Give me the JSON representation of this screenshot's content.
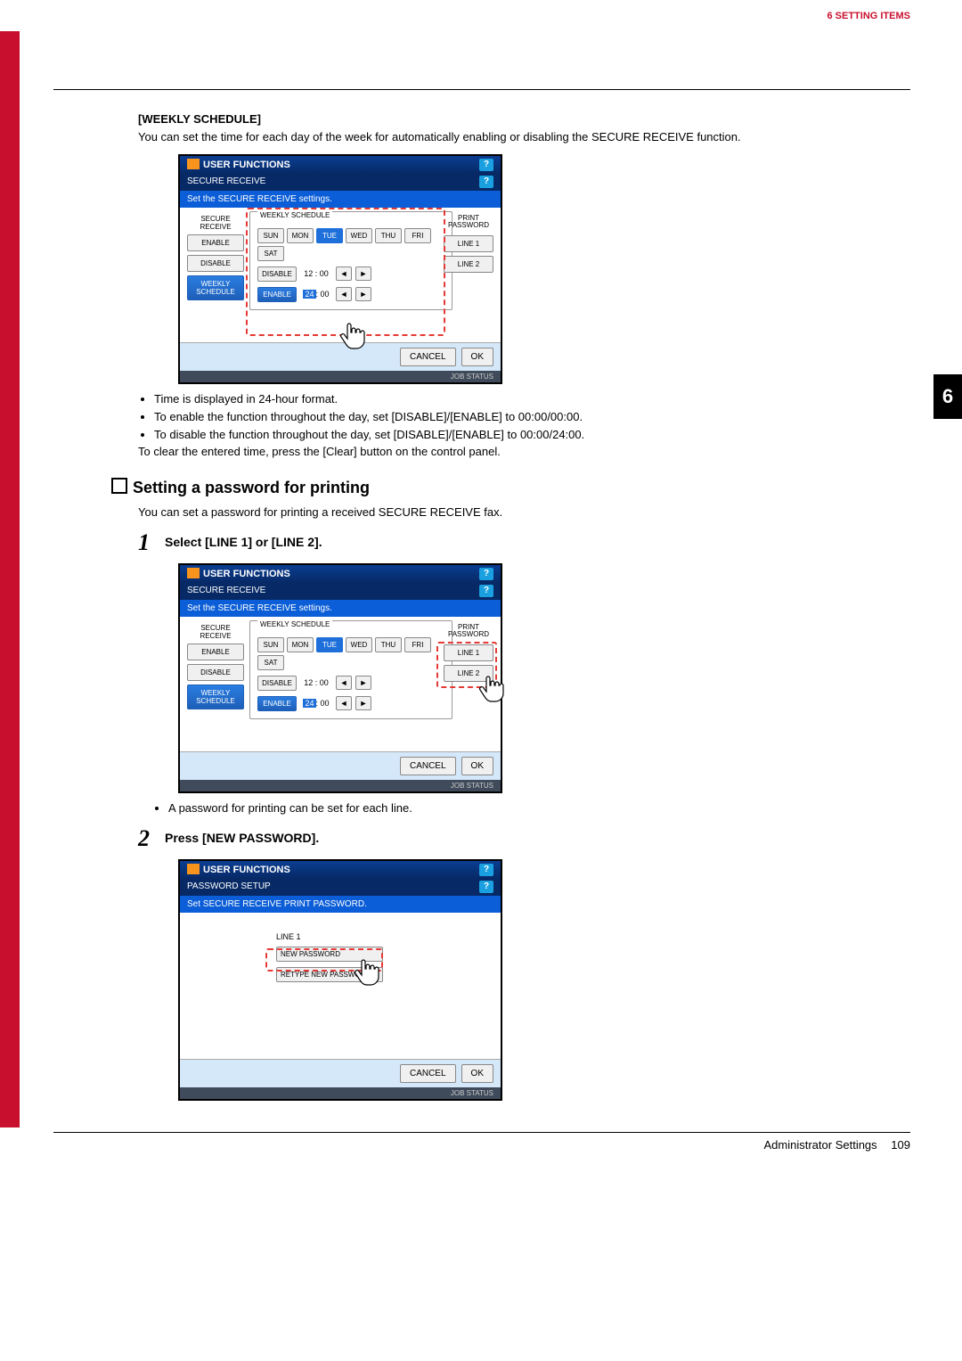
{
  "header": {
    "chapter_prefix": "6",
    "chapter_title": "SETTING ITEMS"
  },
  "chapterTab": "6",
  "weeklySchedule": {
    "heading": "[WEEKLY SCHEDULE]",
    "intro": "You can set the time for each day of the week for automatically enabling or disabling the SECURE RECEIVE function.",
    "bullet1": "Time is displayed in 24-hour format.",
    "bullet2": "To enable the function throughout the day, set [DISABLE]/[ENABLE] to 00:00/00:00.",
    "bullet3": "To disable the function throughout the day, set [DISABLE]/[ENABLE] to 00:00/24:00.",
    "after": "To clear the entered time, press the [Clear] button on the control panel."
  },
  "settingPassword": {
    "heading": "Setting a password for printing",
    "intro": "You can set a password for printing a received SECURE RECEIVE fax.",
    "step1": "Select [LINE 1] or [LINE 2].",
    "step1_bullet": "A password for printing can be set for each line.",
    "step2": "Press [NEW PASSWORD]."
  },
  "screen1": {
    "title": "USER FUNCTIONS",
    "subtitle": "SECURE RECEIVE",
    "instr": "Set the SECURE RECEIVE settings.",
    "left_label": "SECURE RECEIVE",
    "enable": "ENABLE",
    "disable": "DISABLE",
    "weekly": "WEEKLY SCHEDULE",
    "panel_title": "WEEKLY SCHEDULE",
    "days": {
      "sun": "SUN",
      "mon": "MON",
      "tue": "TUE",
      "wed": "WED",
      "thu": "THU",
      "fri": "FRI",
      "sat": "SAT"
    },
    "row_disable": "DISABLE",
    "row_disable_time": "12 : 00",
    "row_enable": "ENABLE",
    "row_enable_time0": "24",
    "row_enable_time1": ": 00",
    "arrow_left": "◄",
    "arrow_right": "►",
    "right_label": "PRINT PASSWORD",
    "line1": "LINE 1",
    "line2": "LINE 2",
    "cancel": "CANCEL",
    "ok": "OK",
    "status": "JOB STATUS",
    "help": "?"
  },
  "screen3": {
    "title": "USER FUNCTIONS",
    "subtitle": "PASSWORD SETUP",
    "instr": "Set SECURE RECEIVE PRINT PASSWORD.",
    "line_label": "LINE 1",
    "newpw": "NEW PASSWORD",
    "retype": "RETYPE NEW PASSWORD",
    "cancel": "CANCEL",
    "ok": "OK",
    "status": "JOB STATUS",
    "help": "?"
  },
  "footer": {
    "section": "Administrator Settings",
    "page": "109"
  },
  "stepNums": {
    "one": "1",
    "two": "2"
  }
}
